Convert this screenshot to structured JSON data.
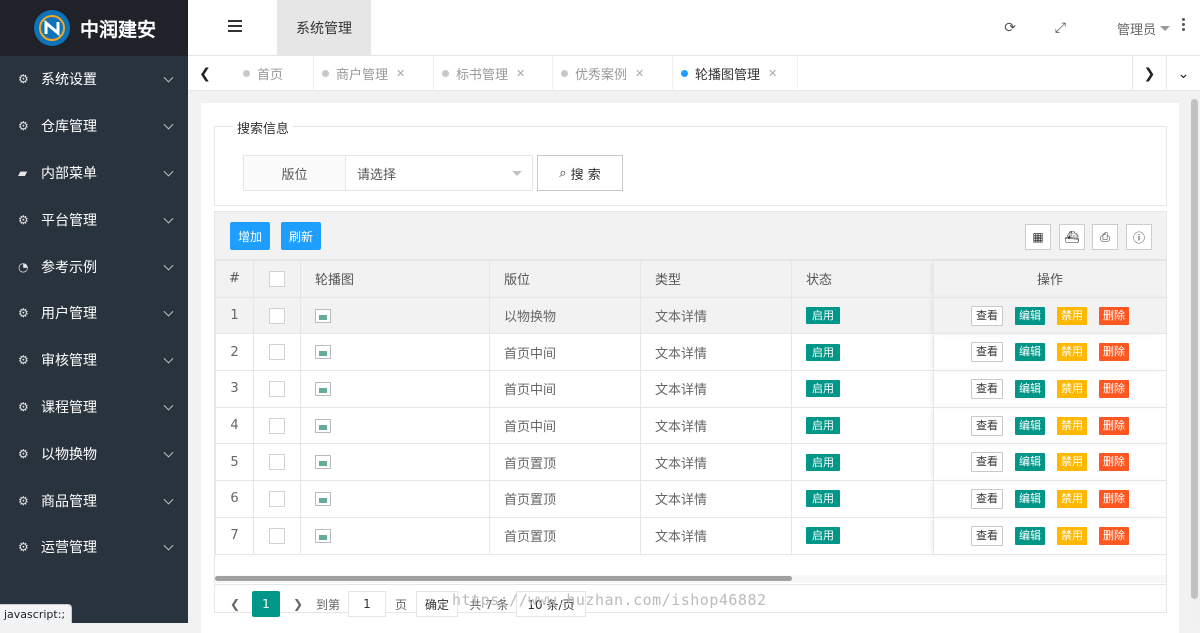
{
  "brand": {
    "name": "中润建安",
    "logo_letter": "N",
    "logo_color": "#0e73b8"
  },
  "sidebar": {
    "items": [
      {
        "label": "系统设置",
        "icon": "gears-icon"
      },
      {
        "label": "仓库管理",
        "icon": "gears-icon"
      },
      {
        "label": "内部菜单",
        "icon": "folder-icon"
      },
      {
        "label": "平台管理",
        "icon": "gears-icon"
      },
      {
        "label": "参考示例",
        "icon": "dashboard-icon"
      },
      {
        "label": "用户管理",
        "icon": "gears-icon"
      },
      {
        "label": "审核管理",
        "icon": "gears-icon"
      },
      {
        "label": "课程管理",
        "icon": "gears-icon"
      },
      {
        "label": "以物换物",
        "icon": "gears-icon"
      },
      {
        "label": "商品管理",
        "icon": "gears-icon"
      },
      {
        "label": "运营管理",
        "icon": "gears-icon"
      }
    ]
  },
  "status_hint": "javascript:;",
  "header": {
    "active_top_tab": "系统管理",
    "user": "管理员"
  },
  "tabs": [
    {
      "label": "首页",
      "closable": false,
      "active": false
    },
    {
      "label": "商户管理",
      "closable": true,
      "active": false
    },
    {
      "label": "标书管理",
      "closable": true,
      "active": false
    },
    {
      "label": "优秀案例",
      "closable": true,
      "active": false
    },
    {
      "label": "轮播图管理",
      "closable": true,
      "active": true
    }
  ],
  "search": {
    "legend": "搜索信息",
    "position_label": "版位",
    "position_placeholder": "请选择",
    "button_label": "搜 索"
  },
  "toolbar": {
    "add_label": "增加",
    "refresh_label": "刷新"
  },
  "table": {
    "columns": [
      "#",
      "",
      "轮播图",
      "版位",
      "类型",
      "状态",
      "操作"
    ],
    "rows": [
      {
        "index": "1",
        "position": "以物换物",
        "type": "文本详情",
        "status": "启用"
      },
      {
        "index": "2",
        "position": "首页中间",
        "type": "文本详情",
        "status": "启用"
      },
      {
        "index": "3",
        "position": "首页中间",
        "type": "文本详情",
        "status": "启用"
      },
      {
        "index": "4",
        "position": "首页中间",
        "type": "文本详情",
        "status": "启用"
      },
      {
        "index": "5",
        "position": "首页置顶",
        "type": "文本详情",
        "status": "启用"
      },
      {
        "index": "6",
        "position": "首页置顶",
        "type": "文本详情",
        "status": "启用"
      },
      {
        "index": "7",
        "position": "首页置顶",
        "type": "文本详情",
        "status": "启用"
      }
    ],
    "actions": {
      "view": "查看",
      "edit": "编辑",
      "disable": "禁用",
      "delete": "删除"
    }
  },
  "pager": {
    "current": "1",
    "goto_prefix": "到第",
    "goto_value": "1",
    "goto_suffix": "页",
    "confirm": "确定",
    "total": "共 7 条",
    "page_size": "10 条/页"
  },
  "watermark": "https://www.huzhan.com/ishop46882",
  "colors": {
    "primary": "#1e9fff",
    "teal": "#009688",
    "warn": "#ffb800",
    "danger": "#ff5722",
    "sidebar": "#28333e"
  }
}
